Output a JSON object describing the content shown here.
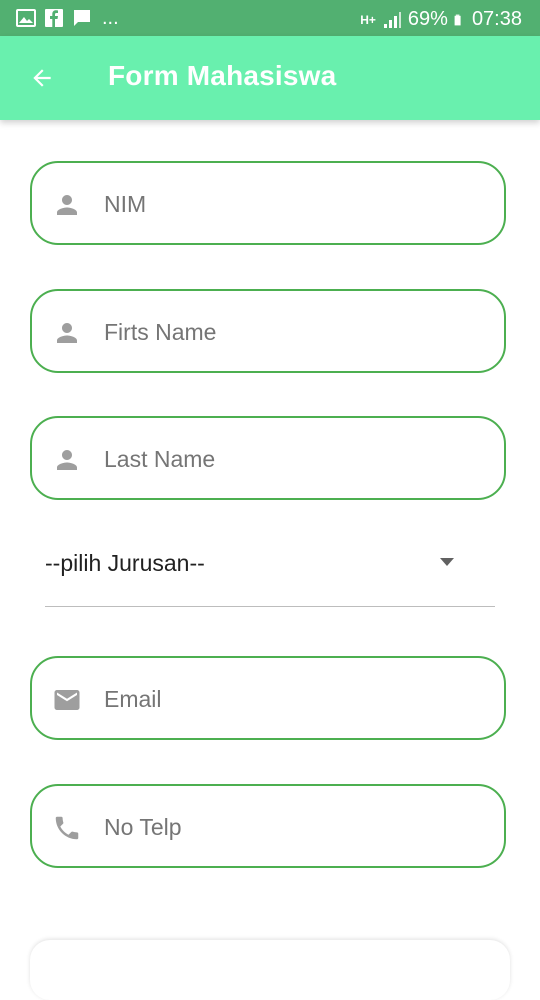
{
  "statusbar": {
    "more": "...",
    "network": "H+",
    "battery_pct": "69%",
    "time": "07:38"
  },
  "appbar": {
    "title": "Form Mahasiswa"
  },
  "form": {
    "nim_placeholder": "NIM",
    "first_name_placeholder": "Firts Name",
    "last_name_placeholder": "Last Name",
    "jurusan_selected": "--pilih Jurusan--",
    "email_placeholder": "Email",
    "telp_placeholder": "No Telp"
  },
  "colors": {
    "statusbar": "#52b071",
    "appbar": "#69f0ae",
    "field_border": "#4caf50",
    "icon": "#9e9e9e"
  }
}
